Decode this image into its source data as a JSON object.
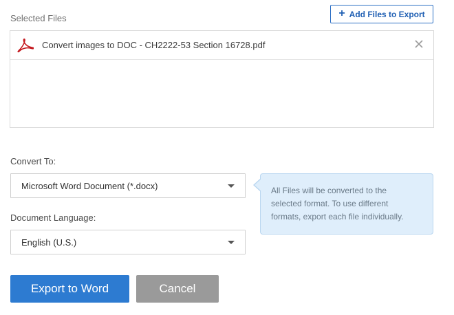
{
  "selected_files": {
    "label": "Selected Files",
    "add_button_label": "Add Files to Export",
    "files": [
      {
        "name": "Convert images to DOC - CH2222-53 Section 16728.pdf",
        "icon": "pdf-icon"
      }
    ]
  },
  "convert_to": {
    "label": "Convert To:",
    "selected": "Microsoft Word Document (*.docx)"
  },
  "document_language": {
    "label": "Document Language:",
    "selected": "English (U.S.)"
  },
  "tooltip": {
    "line1": "All Files will be converted to the",
    "line2": "selected format. To use different",
    "line3": "formats, export each file individually."
  },
  "actions": {
    "export_label": "Export to Word",
    "cancel_label": "Cancel"
  },
  "colors": {
    "accent": "#2d7bd1",
    "pdf_red": "#c4191f",
    "tip_bg": "#dfeefb",
    "cancel_gray": "#9a9a9a"
  }
}
